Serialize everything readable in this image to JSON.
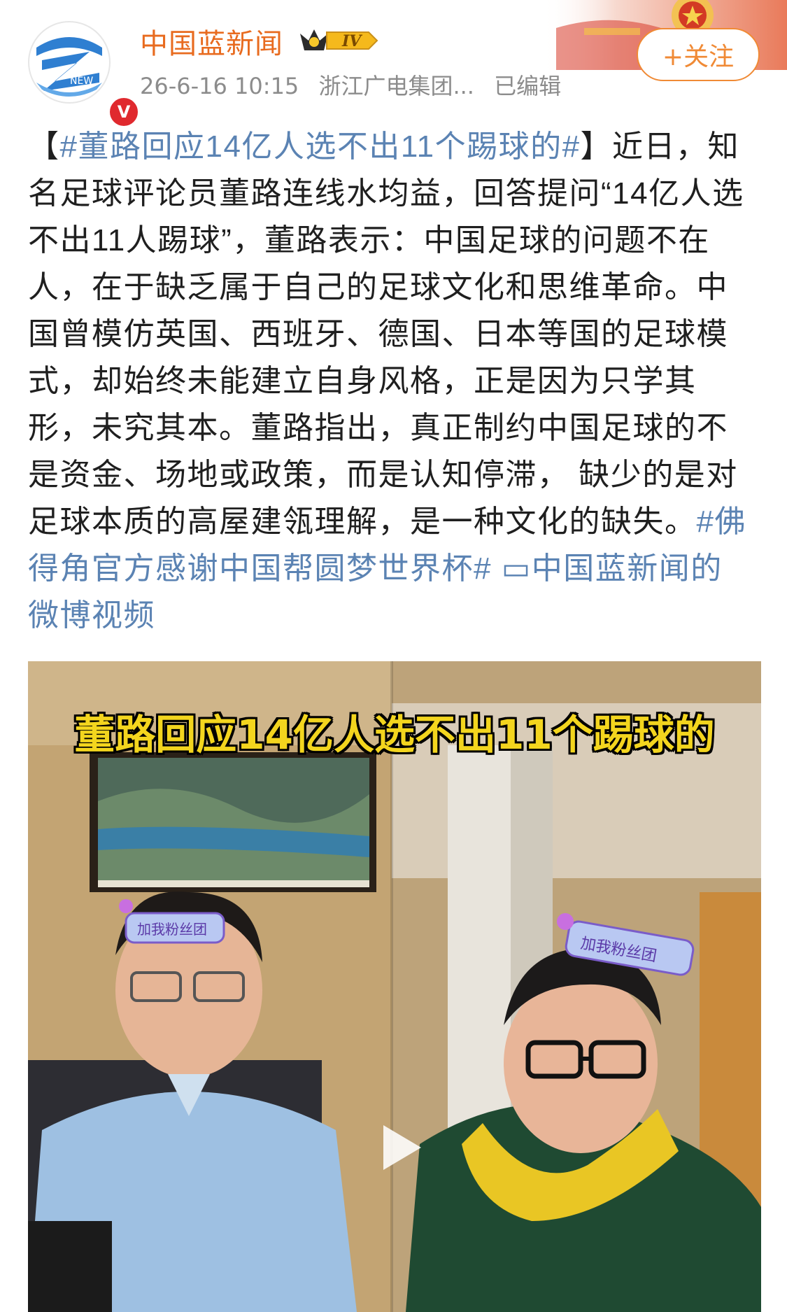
{
  "header": {
    "account_name": "中国蓝新闻",
    "level_badge": "IV",
    "timestamp": "26-6-16 10:15",
    "source": "浙江广电集团...",
    "edited_label": "已编辑",
    "follow_label": "+关注",
    "avatar_text": "NEW",
    "verified_mark": "V"
  },
  "post": {
    "lines": [
      [
        {
          "text": "【",
          "link": false
        },
        {
          "text": "#董路回应14亿人选不出11个踢球的#",
          "link": true
        },
        {
          "text": "】近日，知",
          "link": false
        }
      ],
      [
        {
          "text": "名足球评论员董路连线水均益，回答提问“14亿人选",
          "link": false
        }
      ],
      [
        {
          "text": "不出11人踢球”，董路表示：中国足球的问题不在",
          "link": false
        }
      ],
      [
        {
          "text": "人，在于缺乏属于自己的足球文化和思维革命。中",
          "link": false
        }
      ],
      [
        {
          "text": "国曾模仿英国、西班牙、德国、日本等国的足球模",
          "link": false
        }
      ],
      [
        {
          "text": "式，却始终未能建立自身风格，正是因为只学其",
          "link": false
        }
      ],
      [
        {
          "text": "形，未究其本。董路指出，真正制约中国足球的不",
          "link": false
        }
      ],
      [
        {
          "text": "是资金、场地或政策，而是认知停滞， 缺少的是对",
          "link": false
        }
      ],
      [
        {
          "text": "足球本质的高屋建瓴理解，是一种文化的缺失。",
          "link": false
        },
        {
          "text": "#佛",
          "link": true
        }
      ],
      [
        {
          "text": "得角官方感谢中国帮圆梦世界杯#",
          "link": true
        },
        {
          "text": " ",
          "link": false
        },
        {
          "text": "▭中国蓝新闻的",
          "link": true
        }
      ],
      [
        {
          "text": "微博视频",
          "link": true
        }
      ]
    ]
  },
  "video": {
    "title": "董路回应14亿人选不出11个踢球的",
    "sticker_left": "加我粉丝团",
    "sticker_right": "加我粉丝团"
  },
  "colors": {
    "name": "#e86b1f",
    "link": "#5b83b3",
    "follow": "#f08a35",
    "meta": "#8c8c8c",
    "video_title": "#f3d51e"
  },
  "icons": [
    "zhejiang-tv-logo-icon",
    "verified-v-icon",
    "crown-level-icon",
    "video-camera-icon",
    "play-icon"
  ]
}
